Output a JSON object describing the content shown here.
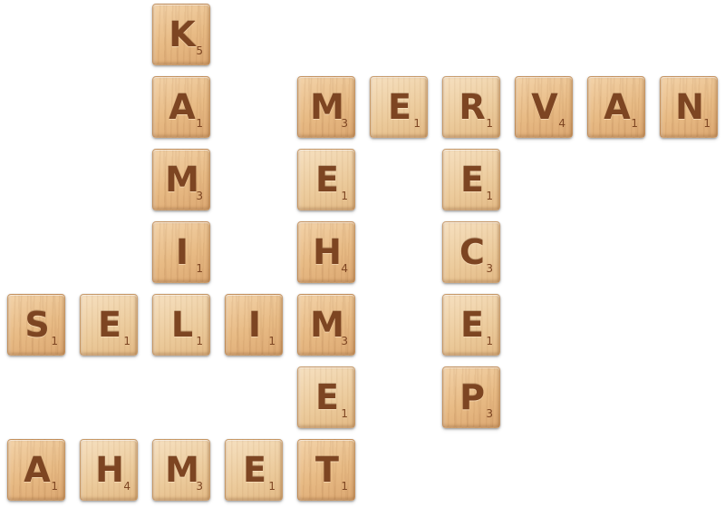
{
  "tiles": [
    {
      "letter": "K",
      "points": "5"
    },
    {
      "letter": "A",
      "points": "1"
    },
    {
      "letter": "M",
      "points": "3"
    },
    {
      "letter": "I",
      "points": "1"
    },
    {
      "letter": "M",
      "points": "3"
    },
    {
      "letter": "E",
      "points": "1"
    },
    {
      "letter": "R",
      "points": "1"
    },
    {
      "letter": "V",
      "points": "4"
    },
    {
      "letter": "A",
      "points": "1"
    },
    {
      "letter": "N",
      "points": "1"
    },
    {
      "letter": "E",
      "points": "1"
    },
    {
      "letter": "E",
      "points": "1"
    },
    {
      "letter": "H",
      "points": "4"
    },
    {
      "letter": "C",
      "points": "3"
    },
    {
      "letter": "S",
      "points": "1"
    },
    {
      "letter": "E",
      "points": "1"
    },
    {
      "letter": "L",
      "points": "1"
    },
    {
      "letter": "I",
      "points": "1"
    },
    {
      "letter": "M",
      "points": "3"
    },
    {
      "letter": "E",
      "points": "1"
    },
    {
      "letter": "E",
      "points": "1"
    },
    {
      "letter": "P",
      "points": "3"
    },
    {
      "letter": "A",
      "points": "1"
    },
    {
      "letter": "H",
      "points": "4"
    },
    {
      "letter": "M",
      "points": "3"
    },
    {
      "letter": "E",
      "points": "1"
    },
    {
      "letter": "T",
      "points": "1"
    }
  ]
}
